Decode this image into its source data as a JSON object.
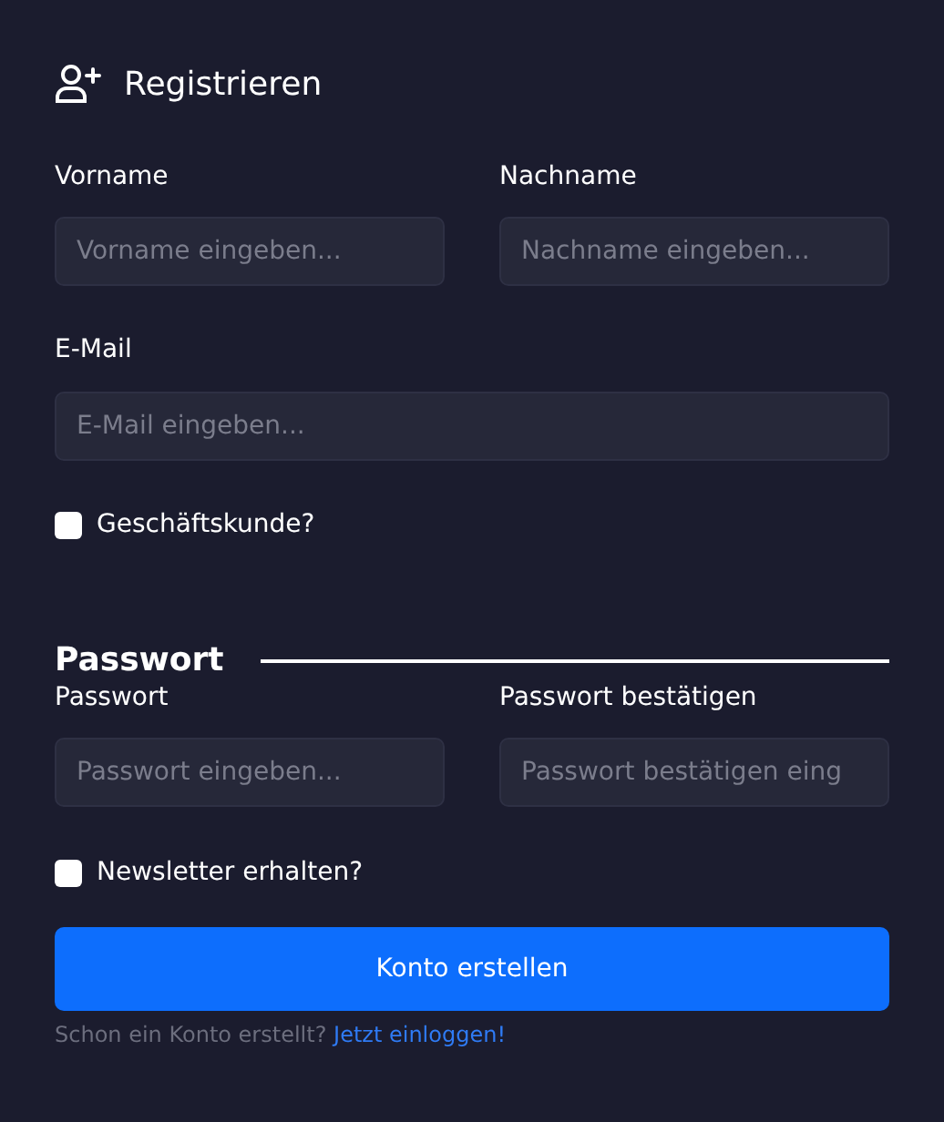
{
  "title": "Registrieren",
  "name_fields": [
    {
      "label": "Vorname",
      "placeholder": "Vorname eingeben..."
    },
    {
      "label": "Nachname",
      "placeholder": "Nachname eingeben..."
    }
  ],
  "email_field": {
    "label": "E-Mail",
    "placeholder": "E-Mail eingeben..."
  },
  "business_checkbox": {
    "label": "Geschäftskunde?",
    "checked": false
  },
  "password_section": {
    "heading": "Passwort",
    "fields": [
      {
        "label": "Passwort",
        "placeholder": "Passwort eingeben..."
      },
      {
        "label": "Passwort bestätigen",
        "placeholder": "Passwort bestätigen eing"
      }
    ]
  },
  "newsletter_checkbox": {
    "label": "Newsletter erhalten?",
    "checked": false
  },
  "submit_button": "Konto erstellen",
  "footer": {
    "text": "Schon ein Konto erstellt?",
    "link": "Jetzt einloggen!"
  }
}
